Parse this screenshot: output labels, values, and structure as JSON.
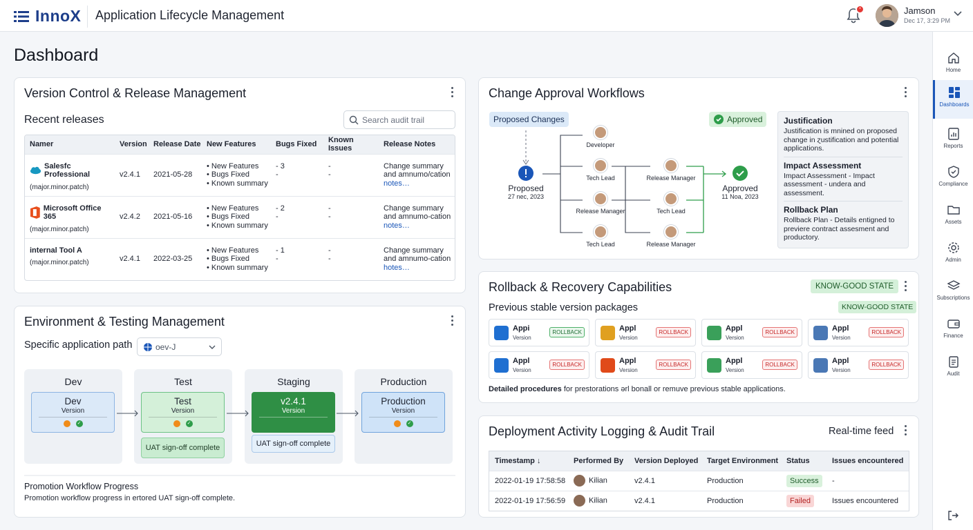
{
  "header": {
    "logo": "InnoX",
    "app_title": "Application Lifecycle Management",
    "notification_count": "•",
    "user_name": "Jamson",
    "user_date": "Dec 17, 3:29 PM"
  },
  "page_title": "Dashboard",
  "sidebar": {
    "items": [
      {
        "label": "Home",
        "icon": "home-icon"
      },
      {
        "label": "Dashboards",
        "icon": "dashboard-icon",
        "active": true
      },
      {
        "label": "Reports",
        "icon": "reports-icon"
      },
      {
        "label": "Compliance",
        "icon": "shield-icon"
      },
      {
        "label": "Assets",
        "icon": "folder-icon"
      },
      {
        "label": "Admin",
        "icon": "gear-icon"
      },
      {
        "label": "Subscriptions",
        "icon": "layers-icon"
      },
      {
        "label": "Finance",
        "icon": "wallet-icon"
      },
      {
        "label": "Audit",
        "icon": "clipboard-icon"
      }
    ]
  },
  "version_control": {
    "title": "Version Control & Release Management",
    "subtitle": "Recent releases",
    "search_placeholder": "Search audit trail",
    "columns": [
      "Namer",
      "Version",
      "Release Date",
      "New Features",
      "Bugs Fixed",
      "Known Issues",
      "Release Notes"
    ],
    "rows": [
      {
        "name": "Salesfc Professional",
        "sub": "(major.minor.patch)",
        "version": "v2.4.1",
        "date": "2021-05-28",
        "features": [
          "• New Features",
          "• Bugs Fixed",
          "• Known summary"
        ],
        "bugs": [
          "- 3",
          "-"
        ],
        "issues": [
          "-",
          "-"
        ],
        "notes": [
          "Change summary",
          "and amnumo/cation"
        ],
        "notes_link": "notes…"
      },
      {
        "name": "Microsoft Office 365",
        "sub": "(major.minor.patch)",
        "version": "v2.4.2",
        "date": "2021-05-16",
        "features": [
          "• New Features",
          "• Bugs Fixed",
          "• Known summary"
        ],
        "bugs": [
          "- 2",
          "-"
        ],
        "issues": [
          "-",
          "-"
        ],
        "notes": [
          "Change summary",
          "and amnumo-cation"
        ],
        "notes_link": "notes…"
      },
      {
        "name": "internal Tool A",
        "sub": "(major.minor.patch)",
        "version": "v2.4.1",
        "date": "2022-03-25",
        "features": [
          "• New Features",
          "• Bugs Fixed",
          "• Known summary"
        ],
        "bugs": [
          "- 1",
          "-"
        ],
        "issues": [
          "-",
          "-"
        ],
        "notes": [
          "Change summary",
          "and amnumo-cation"
        ],
        "notes_link": "hotes…"
      }
    ]
  },
  "change_approval": {
    "title": "Change Approval Workflows",
    "proposed_label": "Proposed Changes",
    "approved_label": "Approved",
    "proposed_node": "Proposed",
    "proposed_date": "27 nec, 2023",
    "approved_node": "Approved",
    "approved_date": "11 Noa, 2023",
    "roles": {
      "developer": "Developer",
      "tech_lead_1": "Tech Lead",
      "release_manager_1": "Release Manager",
      "tech_lead_2": "Tech Lead",
      "release_manager_2": "Release Manager",
      "tech_lead_3": "Tech Lead",
      "release_manager_3": "Release Manager",
      "tech_lead_4": "Tech Lead"
    },
    "justification": {
      "h1": "Justification",
      "t1": "Justification is mnined on proposed change in ɀustification and potential applications.",
      "h2": "Impact Assessment",
      "t2": "Impact Assessment - Impact assessment - undera and assessment.",
      "h3": "Rollback Plan",
      "t3": "Rollback Plan - Details entigned to previere contract assesment and productory."
    }
  },
  "rollback": {
    "title": "Rollback & Recovery Capabilities",
    "badge": "KNOW-GOOD STATE",
    "subtitle": "Previous stable version packages",
    "badge2": "KNOW-GOOD STATE",
    "packages": [
      {
        "name": "Appi",
        "sub": "Version",
        "btn": "ROLLBACK",
        "style": "green",
        "color": "#1f6fd1"
      },
      {
        "name": "Appl",
        "sub": "Version",
        "btn": "ROLLBACK",
        "style": "red",
        "color": "#e0a020"
      },
      {
        "name": "Appl",
        "sub": "Version",
        "btn": "ROLLBACK",
        "style": "red",
        "color": "#3aa05a"
      },
      {
        "name": "Appl",
        "sub": "Version",
        "btn": "ROLLBACK",
        "style": "red",
        "color": "#4a78b5"
      },
      {
        "name": "Appl",
        "sub": "Version",
        "btn": "ROLLBACK",
        "style": "red",
        "color": "#1f6fd1"
      },
      {
        "name": "Appl",
        "sub": "Version",
        "btn": "ROLLBACK",
        "style": "red",
        "color": "#e04a1a"
      },
      {
        "name": "Appl",
        "sub": "Version",
        "btn": "ROLLBACK",
        "style": "red",
        "color": "#3aa05a"
      },
      {
        "name": "Appl",
        "sub": "Version",
        "btn": "ROLLBACK",
        "style": "red",
        "color": "#4a78b5"
      }
    ],
    "footer_bold": "Detailed procedures",
    "footer_rest": " for prestorations ərl bonall or remuve previous stable applications."
  },
  "environment": {
    "title": "Environment & Testing Management",
    "path_label": "Specific application path",
    "path_value": "oev-J",
    "stages": [
      {
        "header": "Dev",
        "box": "Dev",
        "sub": "Version",
        "uat": ""
      },
      {
        "header": "Test",
        "box": "Test",
        "sub": "Version",
        "uat": "UAT sign-off complete"
      },
      {
        "header": "Staging",
        "box": "v2.4.1",
        "sub": "Version",
        "uat": "UAT sign-off complete"
      },
      {
        "header": "Production",
        "box": "Production",
        "sub": "Version",
        "uat": ""
      }
    ],
    "progress_title": "Promotion Workflow Progress",
    "progress_text": "Promotion workflow progress in ertored UAT sign-off complete."
  },
  "deployment": {
    "title": "Deployment Activity Logging & Audit Trail",
    "feed_label": "Real-time feed",
    "columns": [
      "Timestamp",
      "Performed By",
      "Version Deployed",
      "Target Environment",
      "Status",
      "Issues encountered"
    ],
    "rows": [
      {
        "ts": "2022-01-19 17:58:58",
        "by": "Kilian",
        "ver": "v2.4.1",
        "env": "Production",
        "status": "Success",
        "issues": "-"
      },
      {
        "ts": "2022-01-19 17:56:59",
        "by": "Kilian",
        "ver": "v2.4.1",
        "env": "Production",
        "status": "Failed",
        "issues": "Issues encountered"
      }
    ]
  },
  "colors": {
    "brand": "#1d3e8a",
    "accent": "#1a56b8",
    "success": "#2e9d4a",
    "danger": "#e53935"
  }
}
